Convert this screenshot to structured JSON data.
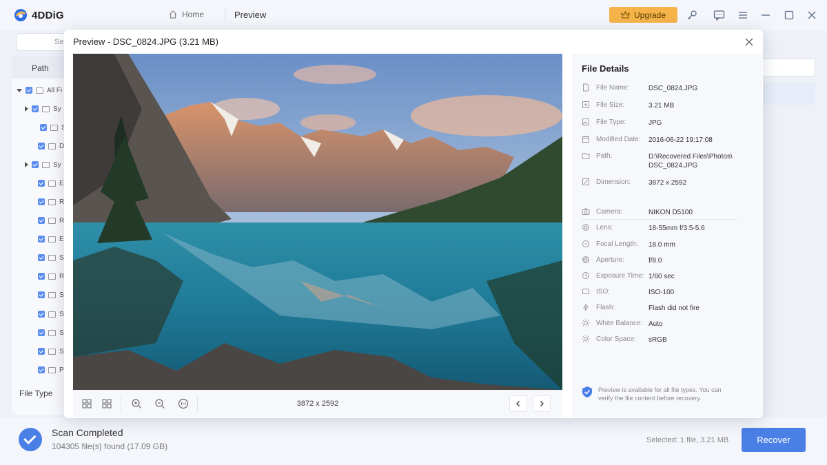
{
  "app": {
    "name": "4DDiG",
    "nav_home": "Home",
    "nav_preview": "Preview",
    "upgrade_label": "Upgrade"
  },
  "background": {
    "search_partial": "Se",
    "path_header": "Path",
    "tree_root": "All Fi",
    "tree_items": [
      "Sy",
      "Sy",
      "Da",
      "Sy",
      "Ex",
      "Re",
      "Ra",
      "Ex",
      "Sy",
      "Re",
      "Sy",
      "Sy",
      "Sy",
      "Sy",
      "Pr"
    ],
    "file_type_label": "File Type"
  },
  "status": {
    "title": "Scan Completed",
    "subtitle": "104305 file(s) found (17.09 GB)",
    "selected": "Selected: 1 file, 3.21 MB",
    "recover_label": "Recover"
  },
  "preview": {
    "title": "Preview - DSC_0824.JPG  (3.21 MB)",
    "dimensions": "3872 x 2592"
  },
  "details": {
    "title": "File Details",
    "file_rows": [
      {
        "label": "File Name:",
        "value": "DSC_0824.JPG",
        "icon": "file-icon"
      },
      {
        "label": "File Size:",
        "value": "3.21 MB",
        "icon": "size-icon"
      },
      {
        "label": "File Type:",
        "value": "JPG",
        "icon": "image-type-icon"
      },
      {
        "label": "Modified Date:",
        "value": "2016-06-22 19:17:08",
        "icon": "calendar-icon"
      },
      {
        "label": "Path:",
        "value": "D:\\Recovered Files\\Photos\\",
        "value2": "DSC_0824.JPG",
        "icon": "folder-icon"
      },
      {
        "label": "Dimension:",
        "value": "3872 x 2592",
        "icon": "dimension-icon"
      }
    ],
    "exif_rows": [
      {
        "label": "Camera:",
        "value": "NIKON D5100",
        "icon": "camera-icon"
      },
      {
        "label": "Lens:",
        "value": "18-55mm f/3.5-5.6",
        "icon": "lens-icon"
      },
      {
        "label": "Focal Length:",
        "value": "18.0 mm",
        "icon": "focal-length-icon"
      },
      {
        "label": "Aperture:",
        "value": "f/8.0",
        "icon": "aperture-icon"
      },
      {
        "label": "Exposure Time:",
        "value": "1/60 sec",
        "icon": "exposure-icon"
      },
      {
        "label": "ISO:",
        "value": "ISO-100",
        "icon": "iso-icon"
      },
      {
        "label": "Flash:",
        "value": "Flash did not fire",
        "icon": "flash-icon"
      },
      {
        "label": "White Balance:",
        "value": "Auto",
        "icon": "white-balance-icon"
      },
      {
        "label": "Color Space:",
        "value": "sRGB",
        "icon": "color-space-icon"
      }
    ],
    "notice_line1": "Preview is available for all file types. You can",
    "notice_line2": "verify the file content before recovery."
  },
  "colors": {
    "accent": "#4a7fe6",
    "upgrade": "#f5b34a"
  }
}
